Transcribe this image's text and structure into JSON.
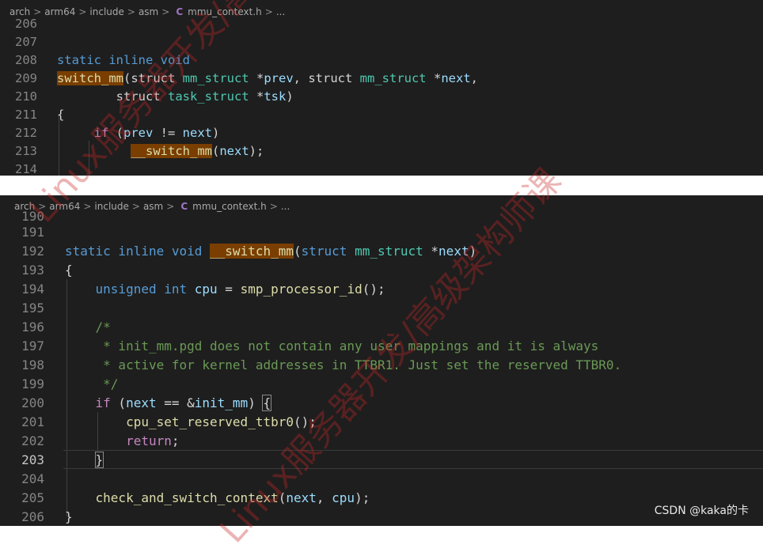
{
  "pane1": {
    "breadcrumb": [
      "arch",
      "arm64",
      "include",
      "asm"
    ],
    "file_icon": "C",
    "file_name": "mmu_context.h",
    "ellipsis": "...",
    "lines": [
      {
        "num": "206"
      },
      {
        "num": "207"
      },
      {
        "num": "208"
      },
      {
        "num": "209"
      },
      {
        "num": "210"
      },
      {
        "num": "211"
      },
      {
        "num": "212"
      },
      {
        "num": "213"
      },
      {
        "num": "214"
      }
    ]
  },
  "pane2": {
    "breadcrumb": [
      "arch",
      "arm64",
      "include",
      "asm"
    ],
    "file_icon": "C",
    "file_name": "mmu_context.h",
    "ellipsis": "...",
    "lines": [
      {
        "num": "190"
      },
      {
        "num": "191"
      },
      {
        "num": "192"
      },
      {
        "num": "193"
      },
      {
        "num": "194"
      },
      {
        "num": "195"
      },
      {
        "num": "196"
      },
      {
        "num": "197"
      },
      {
        "num": "198"
      },
      {
        "num": "199"
      },
      {
        "num": "200"
      },
      {
        "num": "201"
      },
      {
        "num": "202"
      },
      {
        "num": "203"
      },
      {
        "num": "204"
      },
      {
        "num": "205"
      },
      {
        "num": "206"
      }
    ]
  },
  "watermark": "Linux服务器开发/高级架构师课",
  "footer": "CSDN @kaka的卡",
  "breadcrumb_separator": ">",
  "colors": {
    "background": "#1e1e1e",
    "keyword": "#569cd6",
    "type": "#4ec9b0",
    "variable": "#9cdcfe",
    "function": "#dcdcaa",
    "comment": "#6a9955",
    "highlight": "#7a3e00",
    "watermark": "#c82828"
  }
}
